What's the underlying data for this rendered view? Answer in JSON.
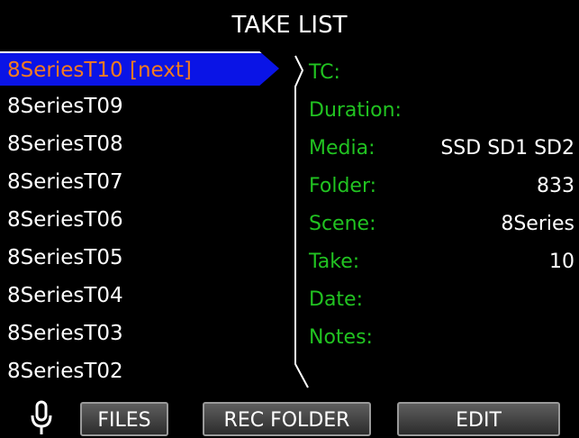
{
  "title": "TAKE LIST",
  "takes": [
    {
      "label": "8SeriesT10 [next]",
      "selected": true
    },
    {
      "label": "8SeriesT09",
      "selected": false
    },
    {
      "label": "8SeriesT08",
      "selected": false
    },
    {
      "label": "8SeriesT07",
      "selected": false
    },
    {
      "label": "8SeriesT06",
      "selected": false
    },
    {
      "label": "8SeriesT05",
      "selected": false
    },
    {
      "label": "8SeriesT04",
      "selected": false
    },
    {
      "label": "8SeriesT03",
      "selected": false
    },
    {
      "label": "8SeriesT02",
      "selected": false
    }
  ],
  "info": {
    "tc": {
      "label": "TC:",
      "value": ""
    },
    "duration": {
      "label": "Duration:",
      "value": ""
    },
    "media": {
      "label": "Media:",
      "value": "SSD SD1 SD2"
    },
    "folder": {
      "label": "Folder:",
      "value": "833"
    },
    "scene": {
      "label": "Scene:",
      "value": "8Series"
    },
    "take": {
      "label": "Take:",
      "value": "10"
    },
    "date": {
      "label": "Date:",
      "value": ""
    },
    "notes": {
      "label": "Notes:",
      "value": ""
    }
  },
  "buttons": {
    "files": "FILES",
    "rec_folder": "REC FOLDER",
    "edit": "EDIT"
  },
  "icons": {
    "mic": "microphone-icon"
  },
  "colors": {
    "selected_bg": "#0a14e6",
    "selected_text": "#f47b20",
    "label_green": "#21c321",
    "text": "#ffffff",
    "background": "#000000"
  }
}
